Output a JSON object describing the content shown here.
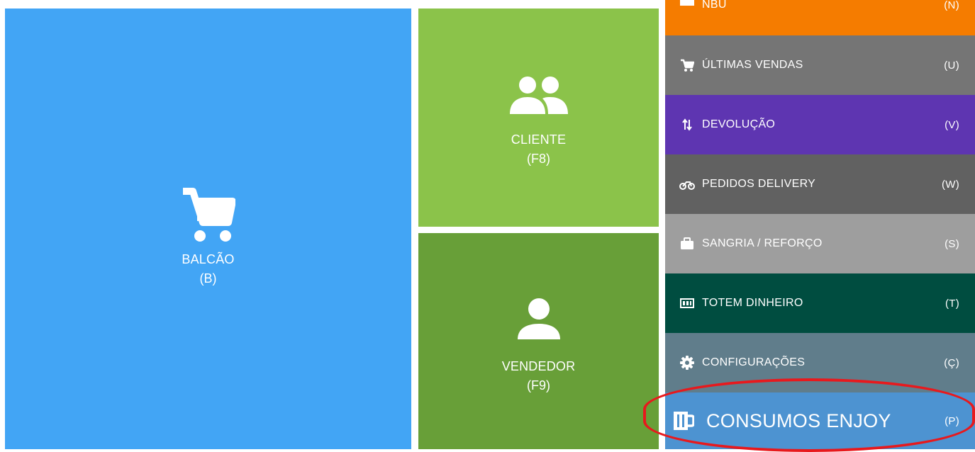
{
  "tiles": {
    "balcao": {
      "label": "BALCÃO",
      "key": "(B)",
      "icon": "cart-icon",
      "color": "#42a5f5"
    },
    "cliente": {
      "label": "CLIENTE",
      "key": "(F8)",
      "icon": "people-icon",
      "color": "#8bc34a"
    },
    "vendedor": {
      "label": "VENDEDOR",
      "key": "(F9)",
      "icon": "person-icon",
      "color": "#689f38"
    }
  },
  "menu": {
    "items": [
      {
        "label": "NBU",
        "key": "(N)",
        "icon": "partial-icon",
        "color": "#f57c00"
      },
      {
        "label": "ÚLTIMAS VENDAS",
        "key": "(U)",
        "icon": "cart-icon",
        "color": "#757575"
      },
      {
        "label": "DEVOLUÇÃO",
        "key": "(V)",
        "icon": "swap-vertical-icon",
        "color": "#5e35b1"
      },
      {
        "label": "PEDIDOS DELIVERY",
        "key": "(W)",
        "icon": "motorbike-icon",
        "color": "#616161"
      },
      {
        "label": "SANGRIA / REFORÇO",
        "key": "(S)",
        "icon": "briefcase-icon",
        "color": "#9e9e9e"
      },
      {
        "label": "TOTEM DINHEIRO",
        "key": "(T)",
        "icon": "cash-icon",
        "color": "#004d40"
      },
      {
        "label": "CONFIGURAÇÕES",
        "key": "(Ç)",
        "icon": "gear-icon",
        "color": "#607d8b"
      },
      {
        "label": "CONSUMOS ENJOY",
        "key": "(P)",
        "icon": "mug-icon",
        "color": "#4d93d1"
      }
    ]
  },
  "annotation": {
    "color": "#e8191d"
  }
}
